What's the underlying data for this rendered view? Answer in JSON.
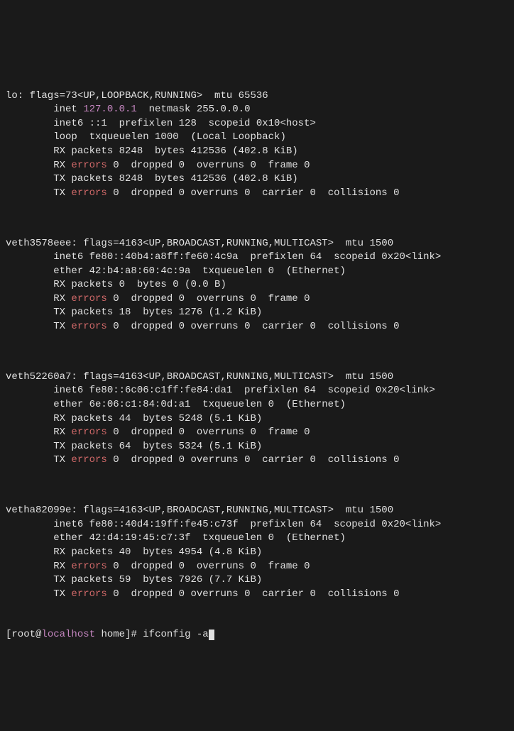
{
  "ifaces": [
    {
      "name": "lo",
      "flags_line": "lo: flags=73<UP,LOOPBACK,RUNNING>  mtu 65536",
      "inet_pre": "        inet ",
      "inet_ip": "127.0.0.1",
      "inet_post": "  netmask 255.0.0.0",
      "inet6_line": "        inet6 ::1  prefixlen 128  scopeid 0x10<host>",
      "extra_line": "        loop  txqueuelen 1000  (Local Loopback)",
      "rx_pkts": "        RX packets 8248  bytes 412536 (402.8 KiB)",
      "rx_err_pre": "        RX ",
      "rx_err_word": "errors",
      "rx_err_post": " 0  dropped 0  overruns 0  frame 0",
      "tx_pkts": "        TX packets 8248  bytes 412536 (402.8 KiB)",
      "tx_err_pre": "        TX ",
      "tx_err_word": "errors",
      "tx_err_post": " 0  dropped 0 overruns 0  carrier 0  collisions 0"
    },
    {
      "name": "veth3578eee",
      "flags_line": "veth3578eee: flags=4163<UP,BROADCAST,RUNNING,MULTICAST>  mtu 1500",
      "inet_pre": "",
      "inet_ip": "",
      "inet_post": "",
      "inet6_line": "        inet6 fe80::40b4:a8ff:fe60:4c9a  prefixlen 64  scopeid 0x20<link>",
      "extra_line": "        ether 42:b4:a8:60:4c:9a  txqueuelen 0  (Ethernet)",
      "rx_pkts": "        RX packets 0  bytes 0 (0.0 B)",
      "rx_err_pre": "        RX ",
      "rx_err_word": "errors",
      "rx_err_post": " 0  dropped 0  overruns 0  frame 0",
      "tx_pkts": "        TX packets 18  bytes 1276 (1.2 KiB)",
      "tx_err_pre": "        TX ",
      "tx_err_word": "errors",
      "tx_err_post": " 0  dropped 0 overruns 0  carrier 0  collisions 0"
    },
    {
      "name": "veth52260a7",
      "flags_line": "veth52260a7: flags=4163<UP,BROADCAST,RUNNING,MULTICAST>  mtu 1500",
      "inet_pre": "",
      "inet_ip": "",
      "inet_post": "",
      "inet6_line": "        inet6 fe80::6c06:c1ff:fe84:da1  prefixlen 64  scopeid 0x20<link>",
      "extra_line": "        ether 6e:06:c1:84:0d:a1  txqueuelen 0  (Ethernet)",
      "rx_pkts": "        RX packets 44  bytes 5248 (5.1 KiB)",
      "rx_err_pre": "        RX ",
      "rx_err_word": "errors",
      "rx_err_post": " 0  dropped 0  overruns 0  frame 0",
      "tx_pkts": "        TX packets 64  bytes 5324 (5.1 KiB)",
      "tx_err_pre": "        TX ",
      "tx_err_word": "errors",
      "tx_err_post": " 0  dropped 0 overruns 0  carrier 0  collisions 0"
    },
    {
      "name": "vetha82099e",
      "flags_line": "vetha82099e: flags=4163<UP,BROADCAST,RUNNING,MULTICAST>  mtu 1500",
      "inet_pre": "",
      "inet_ip": "",
      "inet_post": "",
      "inet6_line": "        inet6 fe80::40d4:19ff:fe45:c73f  prefixlen 64  scopeid 0x20<link>",
      "extra_line": "        ether 42:d4:19:45:c7:3f  txqueuelen 0  (Ethernet)",
      "rx_pkts": "        RX packets 40  bytes 4954 (4.8 KiB)",
      "rx_err_pre": "        RX ",
      "rx_err_word": "errors",
      "rx_err_post": " 0  dropped 0  overruns 0  frame 0",
      "tx_pkts": "        TX packets 59  bytes 7926 (7.7 KiB)",
      "tx_err_pre": "        TX ",
      "tx_err_word": "errors",
      "tx_err_post": " 0  dropped 0 overruns 0  carrier 0  collisions 0"
    }
  ],
  "prompt": {
    "lbracket": "[",
    "user": "root",
    "at": "@",
    "host": "localhost",
    "dir": " home",
    "rbracket": "]# ",
    "command": "ifconfig -a"
  }
}
